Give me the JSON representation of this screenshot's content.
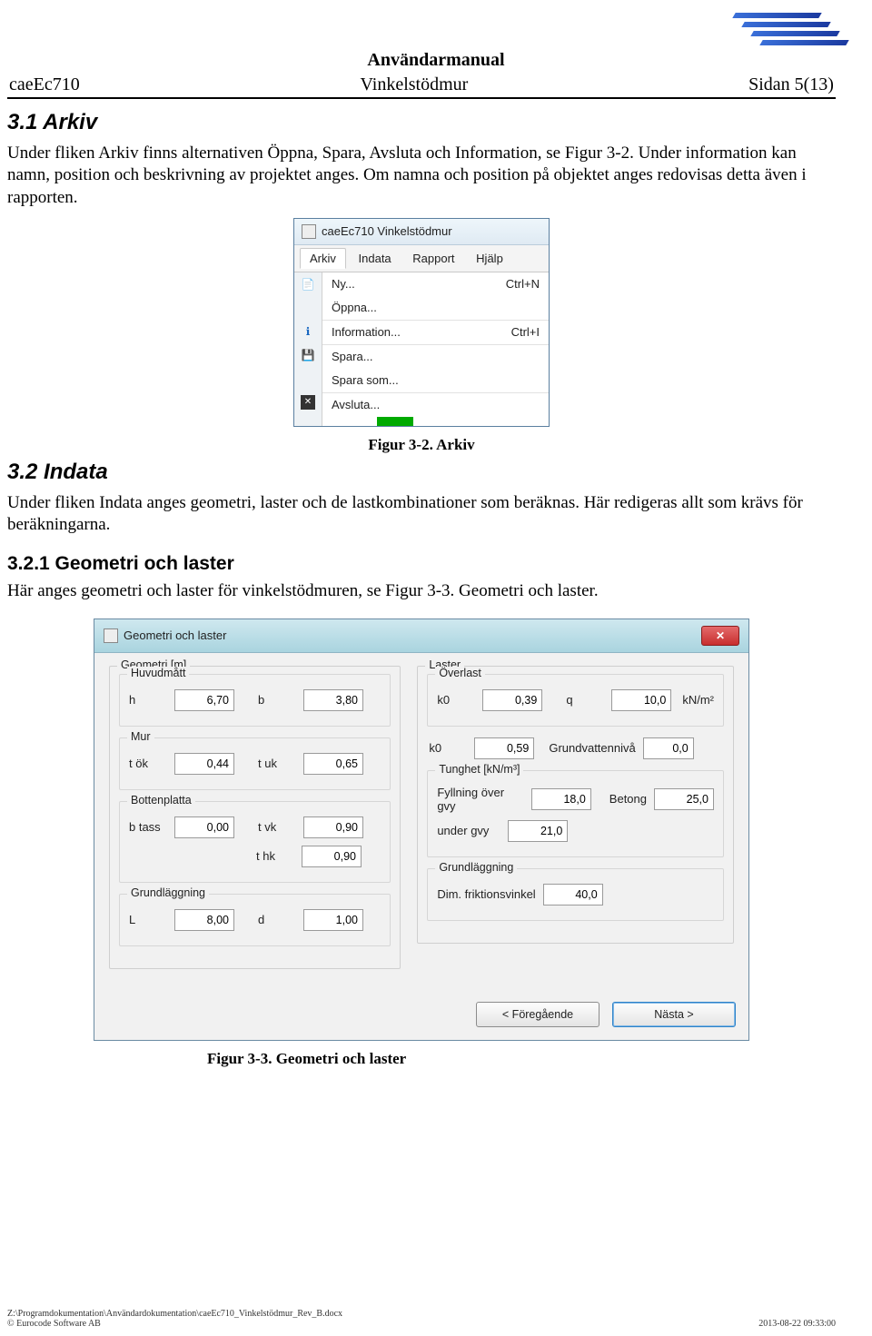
{
  "header": {
    "title": "Användarmanual",
    "left": "caeEc710",
    "center": "Vinkelstödmur",
    "right": "Sidan 5(13)"
  },
  "sec31": {
    "heading": "3.1  Arkiv",
    "p": "Under fliken Arkiv finns alternativen Öppna, Spara, Avsluta och Information, se Figur 3-2. Under information kan namn, position och beskrivning av projektet anges. Om namna och position på objektet anges redovisas detta även i rapporten."
  },
  "arkiv": {
    "title": "caeEc710 Vinkelstödmur",
    "menubar": [
      "Arkiv",
      "Indata",
      "Rapport",
      "Hjälp"
    ],
    "items": [
      {
        "label": "Ny...",
        "short": "Ctrl+N"
      },
      {
        "label": "Öppna...",
        "short": ""
      },
      {
        "label": "Information...",
        "short": "Ctrl+I"
      },
      {
        "label": "Spara...",
        "short": ""
      },
      {
        "label": "Spara som...",
        "short": ""
      },
      {
        "label": "Avsluta...",
        "short": ""
      }
    ]
  },
  "figcap1": "Figur 3-2. Arkiv",
  "sec32": {
    "heading": "3.2  Indata",
    "p": "Under fliken Indata anges geometri, laster och de lastkombinationer som beräknas. Här redigeras allt som krävs för beräkningarna."
  },
  "sec321": {
    "heading": "3.2.1  Geometri och laster",
    "p": "Här anges geometri och laster för vinkelstödmuren, se Figur 3-3. Geometri och laster."
  },
  "geo": {
    "title": "Geometri och laster",
    "geom_title": "Geometri [m]",
    "laster_title": "Laster",
    "huvud_title": "Huvudmått",
    "mur_title": "Mur",
    "bp_title": "Bottenplatta",
    "grund_title": "Grundläggning",
    "over_title": "Överlast",
    "tung_title": "Tunghet [kN/m³]",
    "grund2_title": "Grundläggning",
    "h_lab": "h",
    "h": "6,70",
    "b_lab": "b",
    "b": "3,80",
    "tok_lab": "t ök",
    "tok": "0,44",
    "tuk_lab": "t uk",
    "tuk": "0,65",
    "btass_lab": "b tass",
    "btass": "0,00",
    "tvk_lab": "t vk",
    "tvk": "0,90",
    "thk_lab": "t hk",
    "thk": "0,90",
    "L_lab": "L",
    "L": "8,00",
    "d_lab": "d",
    "d": "1,00",
    "k0a_lab": "k0",
    "k0a": "0,39",
    "q_lab": "q",
    "q": "10,0",
    "q_unit": "kN/m²",
    "k0b_lab": "k0",
    "k0b": "0,59",
    "gvn_lab": "Grundvattennivå",
    "gvn": "0,0",
    "fyll_lab": "Fyllning över gvy",
    "fyll": "18,0",
    "bet_lab": "Betong",
    "bet": "25,0",
    "under_lab": "under gvy",
    "under": "21,0",
    "frik_lab": "Dim. friktionsvinkel",
    "frik": "40,0",
    "prev": "< Föregående",
    "next": "Nästa >"
  },
  "figcap2": "Figur 3-3. Geometri och laster",
  "footer": {
    "path": "Z:\\Programdokumentation\\Användardokumentation\\caeEc710_Vinkelstödmur_Rev_B.docx",
    "copy": "© Eurocode Software AB",
    "date": "2013-08-22 09:33:00"
  }
}
